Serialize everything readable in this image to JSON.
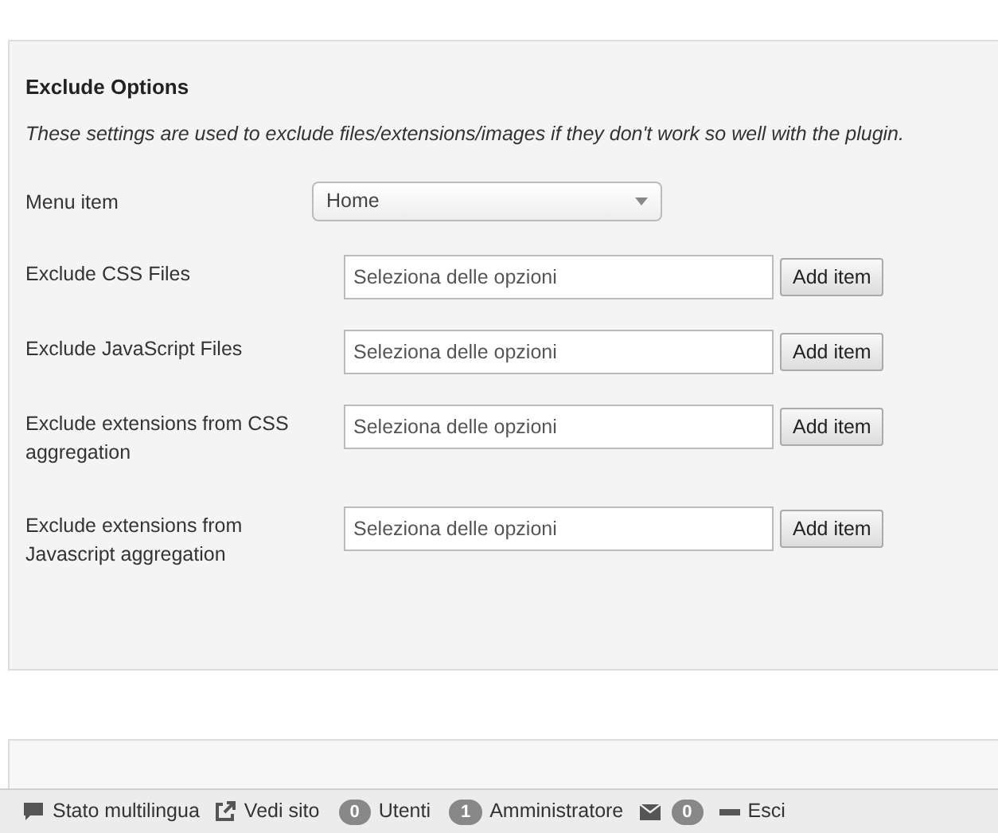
{
  "exclude_options": {
    "title": "Exclude Options",
    "description": "These settings are used to exclude files/extensions/images if they don't work so well with the plugin.",
    "fields": [
      {
        "kind": "select",
        "label": "Menu item",
        "value": "Home"
      },
      {
        "kind": "list",
        "label": "Exclude CSS Files",
        "placeholder": "Seleziona delle opzioni",
        "button": "Add item"
      },
      {
        "kind": "list",
        "label": "Exclude JavaScript Files",
        "placeholder": "Seleziona delle opzioni",
        "button": "Add item"
      },
      {
        "kind": "list",
        "label": "Exclude extensions from CSS aggregation",
        "placeholder": "Seleziona delle opzioni",
        "button": "Add item"
      },
      {
        "kind": "list",
        "label": "Exclude extensions from Javascript aggregation",
        "placeholder": "Seleziona delle opzioni",
        "button": "Add item"
      }
    ]
  },
  "status_bar": [
    {
      "kind": "chat",
      "label": "Stato multilingua"
    },
    {
      "kind": "external",
      "label": "Vedi sito"
    },
    {
      "kind": "count",
      "count": "0",
      "label": "Utenti"
    },
    {
      "kind": "count",
      "count": "1",
      "label": "Amministratore"
    },
    {
      "kind": "mail",
      "count": "0"
    },
    {
      "kind": "logout",
      "label": "Esci"
    }
  ]
}
